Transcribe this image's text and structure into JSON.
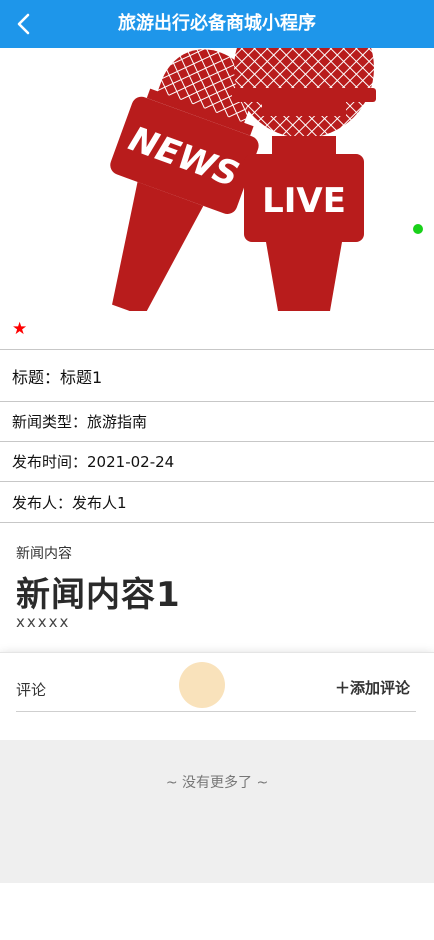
{
  "header": {
    "title": "旅游出行必备商城小程序"
  },
  "detail": {
    "title_label": "标题：",
    "title_value": "标题1",
    "type_label": "新闻类型：",
    "type_value": "旅游指南",
    "time_label": "发布时间：",
    "time_value": "2021-02-24",
    "author_label": "发布人：",
    "author_value": "发布人1"
  },
  "banner": {
    "news_text": "NEWS",
    "live_text": "LIVE",
    "mic_color": "#b81c1c",
    "dot_color": "#19d11a"
  },
  "content": {
    "label": "新闻内容",
    "heading": "新闻内容1",
    "body": "xxxxx"
  },
  "comments": {
    "label": "评论",
    "add_label": "添加评论"
  },
  "footer": {
    "no_more": "~ 没有更多了 ~"
  },
  "icons": {
    "back": "chevron-left-icon",
    "favorite": "star-icon",
    "add": "plus-icon"
  },
  "colors": {
    "header_bg": "#1e96ea",
    "star": "#ff0000"
  }
}
